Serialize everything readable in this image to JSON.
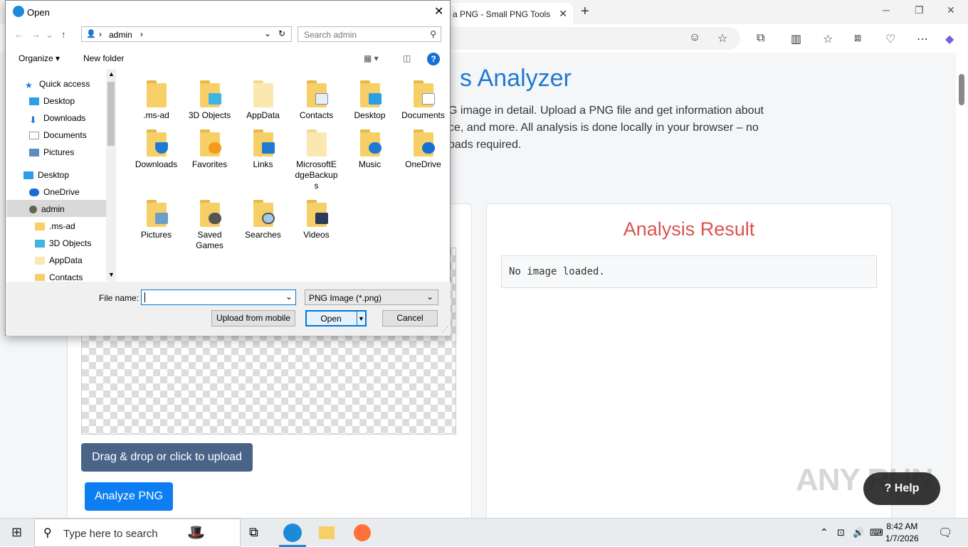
{
  "browser": {
    "tab_title": "e a PNG - Small PNG Tools",
    "new_tab": "+"
  },
  "page": {
    "heading": "s Analyzer",
    "description": "G image in detail. Upload a PNG file and get information about ce, and more. All analysis is done locally in your browser – no oads required.",
    "drag_button": "Drag & drop or click to upload",
    "analyze_button": "Analyze PNG",
    "result_title": "Analysis Result",
    "result_text": "No image loaded.",
    "watermark": "ANY RUN",
    "help": "Help"
  },
  "dialog": {
    "title": "Open",
    "path": "admin",
    "search_placeholder": "Search admin",
    "organize": "Organize",
    "new_folder": "New folder",
    "sidebar": [
      "Quick access",
      "Desktop",
      "Downloads",
      "Documents",
      "Pictures",
      "Desktop",
      "OneDrive",
      "admin",
      ".ms-ad",
      "3D Objects",
      "AppData",
      "Contacts"
    ],
    "files": [
      ".ms-ad",
      "3D Objects",
      "AppData",
      "Contacts",
      "Desktop",
      "Documents",
      "Downloads",
      "Favorites",
      "Links",
      "MicrosoftEdgeBackups",
      "Music",
      "OneDrive",
      "Pictures",
      "Saved Games",
      "Searches",
      "Videos"
    ],
    "file_name_label": "File name:",
    "file_type": "PNG Image (*.png)",
    "upload_mobile": "Upload from mobile",
    "open": "Open",
    "cancel": "Cancel"
  },
  "taskbar": {
    "search": "Type here to search",
    "time": "8:42 AM",
    "date": "1/7/2026"
  }
}
